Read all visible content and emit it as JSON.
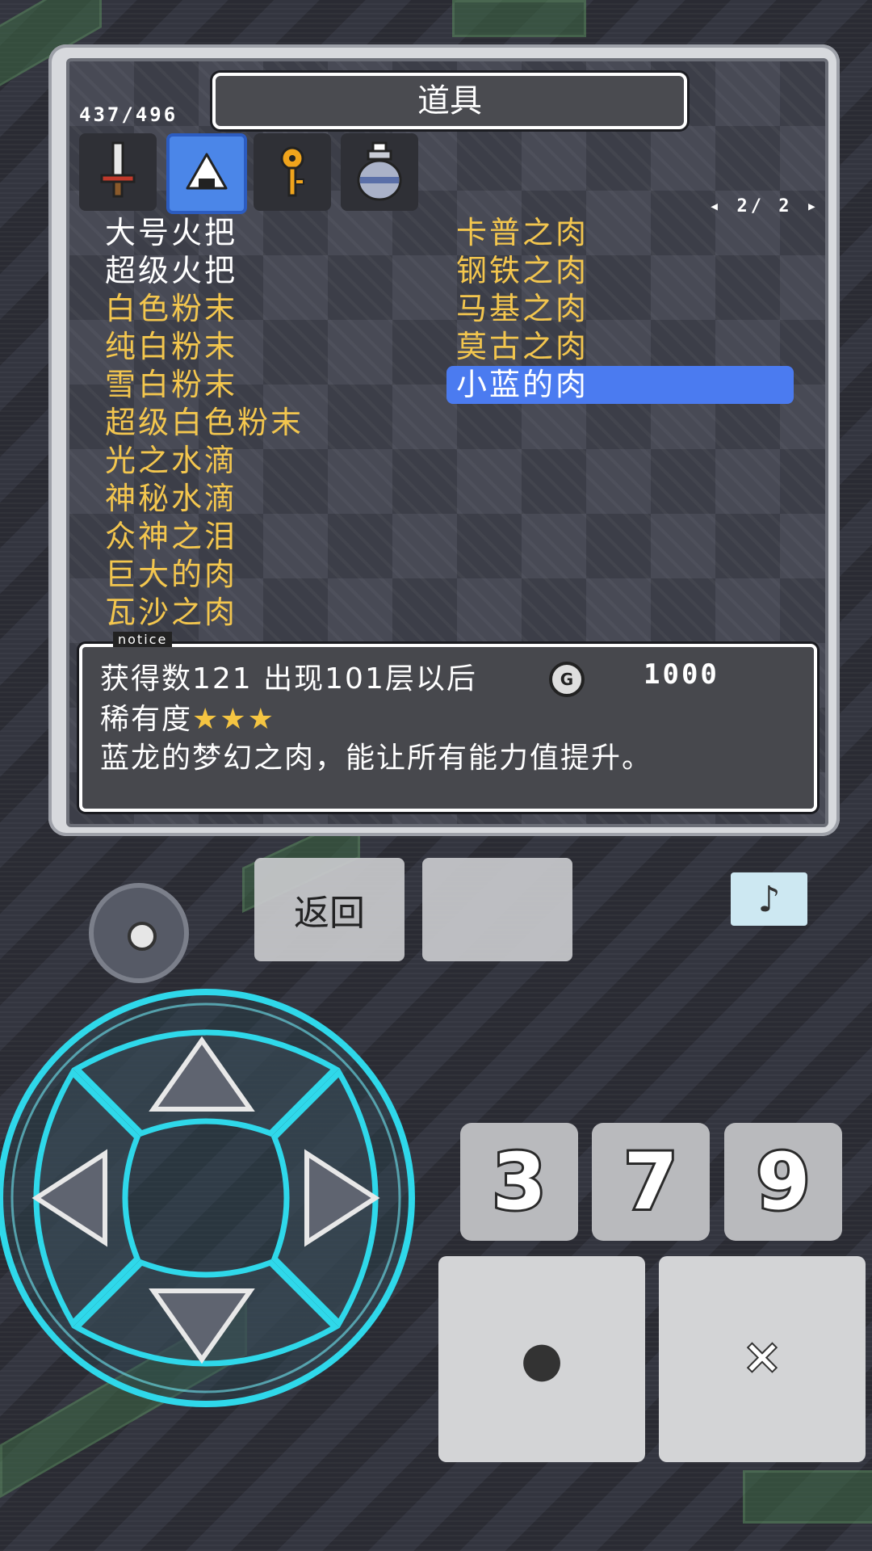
{
  "window": {
    "title": "道具",
    "item_count": "437/496",
    "page": "2/ 2"
  },
  "tabs": [
    {
      "name": "weapons",
      "icon": "sword-icon",
      "active": false
    },
    {
      "name": "consumables",
      "icon": "rice-ball-icon",
      "active": true
    },
    {
      "name": "keys",
      "icon": "key-icon",
      "active": false
    },
    {
      "name": "pots",
      "icon": "pot-icon",
      "active": false
    }
  ],
  "left_items": [
    {
      "label": "大号火把",
      "color": "white"
    },
    {
      "label": "超级火把",
      "color": "white"
    },
    {
      "label": "白色粉末",
      "color": "gold"
    },
    {
      "label": "纯白粉末",
      "color": "gold"
    },
    {
      "label": "雪白粉末",
      "color": "gold"
    },
    {
      "label": "超级白色粉末",
      "color": "gold"
    },
    {
      "label": "光之水滴",
      "color": "gold"
    },
    {
      "label": "神秘水滴",
      "color": "gold"
    },
    {
      "label": "众神之泪",
      "color": "gold"
    },
    {
      "label": "巨大的肉",
      "color": "gold"
    },
    {
      "label": "瓦沙之肉",
      "color": "gold"
    }
  ],
  "right_items": [
    {
      "label": "卡普之肉",
      "selected": false
    },
    {
      "label": "钢铁之肉",
      "selected": false
    },
    {
      "label": "马基之肉",
      "selected": false
    },
    {
      "label": "莫古之肉",
      "selected": false
    },
    {
      "label": "小蓝的肉",
      "selected": true
    }
  ],
  "notice": {
    "tag": "notice",
    "line1": "获得数121 出现101层以后",
    "gold_symbol": "G",
    "price": "1000",
    "rarity_label": "稀有度",
    "rarity_stars": "★★★",
    "description": "蓝龙的梦幻之肉，能让所有能力值提升。"
  },
  "controls": {
    "back_label": "返回",
    "music_symbol": "♪",
    "keys": [
      "3",
      "7",
      "9"
    ],
    "confirm_symbol": "●",
    "cancel_symbol": "✕"
  },
  "colors": {
    "accent": "#4b7bf0",
    "gold_text": "#f3c64e",
    "dpad_glow": "#2fd8ea"
  }
}
